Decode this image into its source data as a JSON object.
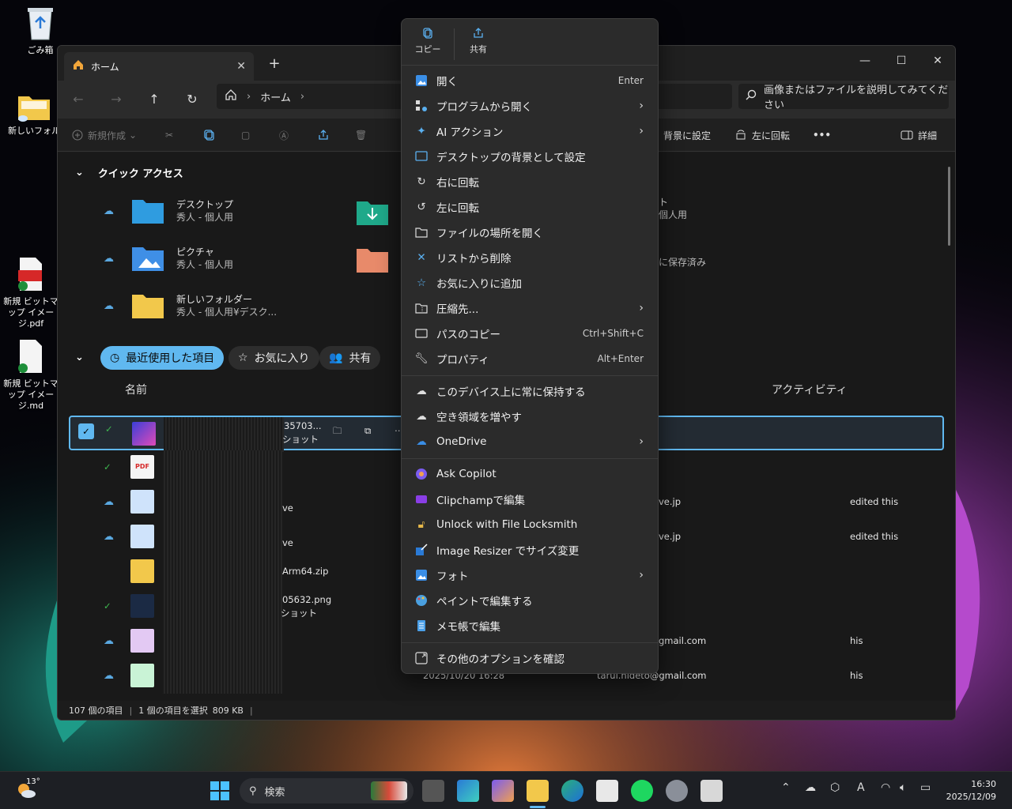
{
  "desktop": {
    "icons": [
      {
        "label": "ごみ箱"
      },
      {
        "label": "新しいフォル"
      },
      {
        "label": "新規 ビットマップ イメージ.pdf",
        "badge": "PDF"
      },
      {
        "label": "新規 ビットマップ イメージ.md"
      }
    ]
  },
  "explorer": {
    "tab_label": "ホーム",
    "tab_close": "✕",
    "new_tab": "+",
    "window_controls": {
      "minimize": "—",
      "maximize": "☐",
      "close": "✕"
    },
    "breadcrumb": [
      "ホーム"
    ],
    "search_placeholder": "画像またはファイルを説明してみてください",
    "toolbar": {
      "new_label": "新規作成",
      "set_background": "背景に設定",
      "rotate_left": "左に回転",
      "more": "•••",
      "details": "詳細"
    },
    "quick_access": {
      "header": "クイック アクセス",
      "items": [
        {
          "name": "デスクトップ",
          "sub": "秀人 - 個人用",
          "color": "#2f9ce0"
        },
        {
          "name": "ピクチャ",
          "sub": "秀人 - 個人用",
          "color": "#3f8fe6"
        },
        {
          "name": "新しいフォルダー",
          "sub": "秀人 - 個人用¥デスク...",
          "color": "#f2c84b"
        }
      ],
      "right_col_fragments": [
        "ト",
        "個人用",
        "に保存済み"
      ]
    },
    "filters": {
      "recent": "最近使用した項目",
      "favorites": "お気に入り",
      "shared": "共有"
    },
    "columns": {
      "name": "名前",
      "activity": "アクティビティ"
    },
    "rows": [
      {
        "name_frag": "35703...",
        "sub_frag": "ショット",
        "selected": true
      },
      {
        "name_frag": "",
        "sub_frag": "",
        "pdf": "PDF"
      },
      {
        "name_frag": "ve",
        "mail": "ve.jp",
        "activity": "edited this"
      },
      {
        "name_frag": "ve",
        "mail": "ve.jp",
        "activity": "edited this"
      },
      {
        "name_frag": "Arm64.zip",
        "sub_frag": ""
      },
      {
        "name_frag": "05632.png",
        "sub_frag": "ショット"
      },
      {
        "name_frag": "",
        "mail": "gmail.com",
        "activity": "his"
      },
      {
        "name_frag": "",
        "date": "2025/10/20 16:28",
        "mail": "tarui.hideto@gmail.com",
        "activity": "his"
      }
    ],
    "status": {
      "count": "107 個の項目",
      "selection": "1 個の項目を選択",
      "size": "809 KB"
    }
  },
  "context_menu": {
    "top_actions": [
      {
        "label": "コピー",
        "icon": "copy-icon"
      },
      {
        "label": "共有",
        "icon": "share-icon"
      }
    ],
    "items": [
      {
        "label": "開く",
        "shortcut": "Enter",
        "icon": "photo-open-icon"
      },
      {
        "label": "プログラムから開く",
        "submenu": true,
        "icon": "open-with-icon"
      },
      {
        "label": "AI アクション",
        "submenu": true,
        "icon": "sparkle-icon"
      },
      {
        "label": "デスクトップの背景として設定",
        "icon": "wallpaper-icon"
      },
      {
        "label": "右に回転",
        "icon": "rotate-right-icon"
      },
      {
        "label": "左に回転",
        "icon": "rotate-left-icon"
      },
      {
        "label": "ファイルの場所を開く",
        "icon": "folder-open-icon"
      },
      {
        "label": "リストから削除",
        "icon": "x-icon"
      },
      {
        "label": "お気に入りに追加",
        "icon": "star-icon"
      },
      {
        "label": "圧縮先...",
        "submenu": true,
        "icon": "zip-icon"
      },
      {
        "label": "パスのコピー",
        "shortcut": "Ctrl+Shift+C",
        "icon": "path-icon"
      },
      {
        "label": "プロパティ",
        "shortcut": "Alt+Enter",
        "icon": "wrench-icon"
      },
      {
        "label": "このデバイス上に常に保持する",
        "icon": "cloud-keep-icon"
      },
      {
        "label": "空き領域を増やす",
        "icon": "cloud-icon"
      },
      {
        "label": "OneDrive",
        "submenu": true,
        "icon": "onedrive-icon"
      },
      {
        "label": "Ask Copilot",
        "icon": "copilot-icon"
      },
      {
        "label": "Clipchampで編集",
        "icon": "clipchamp-icon"
      },
      {
        "label": "Unlock with File Locksmith",
        "icon": "lock-icon"
      },
      {
        "label": "Image Resizer でサイズ変更",
        "icon": "resizer-icon"
      },
      {
        "label": "フォト",
        "submenu": true,
        "icon": "photos-icon"
      },
      {
        "label": "ペイントで編集する",
        "icon": "paint-icon"
      },
      {
        "label": "メモ帳で編集",
        "icon": "notepad-icon"
      },
      {
        "label": "その他のオプションを確認",
        "icon": "more-options-icon"
      }
    ]
  },
  "taskbar": {
    "weather_temp": "13°",
    "search_label": "検索",
    "time": "16:30",
    "date": "2025/12/09",
    "ime": "A"
  }
}
